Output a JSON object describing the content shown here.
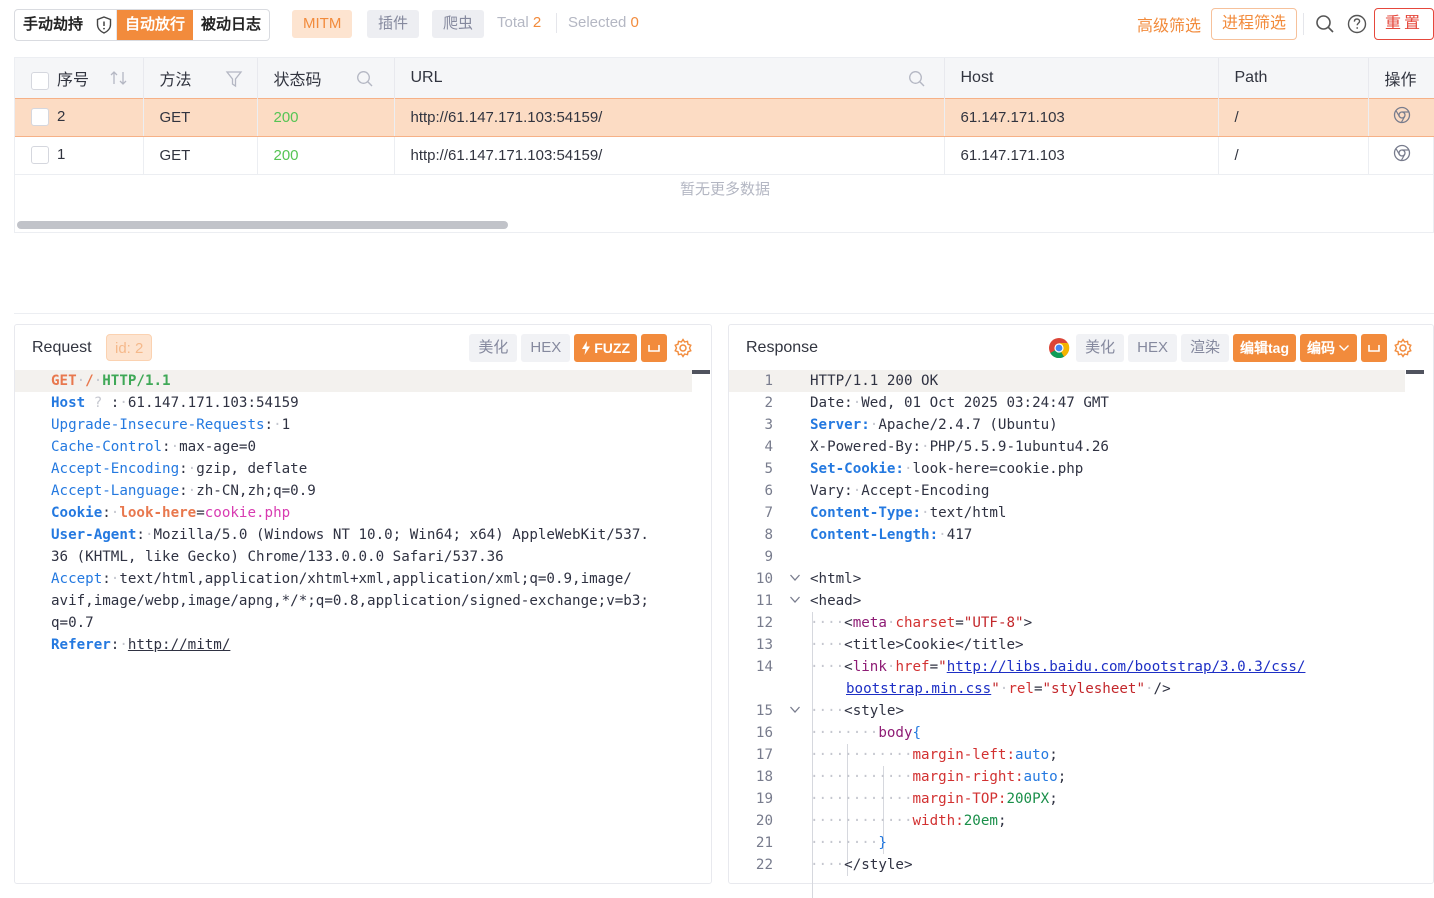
{
  "toolbar": {
    "seg_manual": "手动劫持",
    "seg_auto": "自动放行",
    "seg_passive": "被动日志",
    "tag_mitm": "MITM",
    "tag_plugin": "插件",
    "tag_crawler": "爬虫",
    "total_label": "Total",
    "total_value": "2",
    "selected_label": "Selected",
    "selected_value": "0",
    "advanced_filter": "高级筛选",
    "process_filter": "进程筛选",
    "reset": "重置"
  },
  "table": {
    "headers": {
      "seq": "序号",
      "method": "方法",
      "status": "状态码",
      "url": "URL",
      "host": "Host",
      "path": "Path",
      "ops": "操作"
    },
    "rows": [
      {
        "seq": "2",
        "method": "GET",
        "status": "200",
        "url": "http://61.147.171.103:54159/",
        "host": "61.147.171.103",
        "path": "/",
        "selected": true
      },
      {
        "seq": "1",
        "method": "GET",
        "status": "200",
        "url": "http://61.147.171.103:54159/",
        "host": "61.147.171.103",
        "path": "/",
        "selected": false
      }
    ],
    "no_more": "暂无更多数据"
  },
  "request": {
    "title": "Request",
    "id_tag": "id: 2",
    "btn_beautify": "美化",
    "btn_hex": "HEX",
    "btn_fuzz": "FUZZ",
    "lines": {
      "l1_method": "GET",
      "l1_path": "/",
      "l1_ver": "HTTP/1.1",
      "l2_key": "Host",
      "l2_val": "61.147.171.103:54159",
      "l3_key": "Upgrade-Insecure-Requests",
      "l3_val": "1",
      "l4_key": "Cache-Control",
      "l4_val": "max-age=0",
      "l5_key": "Accept-Encoding",
      "l5_val": "gzip, deflate",
      "l6_key": "Accept-Language",
      "l6_val": "zh-CN,zh;q=0.9",
      "l7_key": "Cookie",
      "l7_name": "look-here",
      "l7_val": "cookie.php",
      "l8_key": "User-Agent",
      "l8_val": "Mozilla/5.0 (Windows NT 10.0; Win64; x64) AppleWebKit/537.",
      "l9_val": "36 (KHTML, like Gecko) Chrome/133.0.0.0 Safari/537.36",
      "l10_key": "Accept",
      "l10_val": "text/html,application/xhtml+xml,application/xml;q=0.9,image/",
      "l11_val": "avif,image/webp,image/apng,*/*;q=0.8,application/signed-exchange;v=b3;",
      "l12_val": "q=0.7",
      "l13_key": "Referer",
      "l13_val": "http://mitm/"
    }
  },
  "response": {
    "title": "Response",
    "btn_beautify": "美化",
    "btn_hex": "HEX",
    "btn_render": "渲染",
    "btn_edit_tag": "编辑tag",
    "btn_encode": "编码",
    "line_numbers": [
      "1",
      "2",
      "3",
      "4",
      "5",
      "6",
      "7",
      "8",
      "9",
      "10",
      "11",
      "12",
      "13",
      "14",
      "15",
      "16",
      "17",
      "18",
      "19",
      "20",
      "21",
      "22"
    ],
    "l1": "HTTP/1.1 200 OK",
    "l2_key": "Date",
    "l2_val": "Wed, 01 Oct 2025 03:24:47 GMT",
    "l3_key": "Server",
    "l3_val": "Apache/2.4.7 (Ubuntu)",
    "l4_key": "X-Powered-By",
    "l4_val": "PHP/5.5.9-1ubuntu4.26",
    "l5_key": "Set-Cookie",
    "l5_val": "look-here=cookie.php",
    "l6_key": "Vary",
    "l6_val": "Accept-Encoding",
    "l7_key": "Content-Type",
    "l7_val": "text/html",
    "l8_key": "Content-Length",
    "l8_val": "417",
    "l10": "<html>",
    "l11": "<head>",
    "l12_tag": "meta",
    "l12_attr": "charset",
    "l12_val": "\"UTF-8\"",
    "l13_open": "title",
    "l13_text": "Cookie",
    "l14_tag": "link",
    "l14_attr": "href",
    "l14_url1": "http://libs.baidu.com/bootstrap/3.0.3/css/",
    "l14_url2": "bootstrap.min.css",
    "l14_attr2": "rel",
    "l14_val2": "\"stylesheet\"",
    "l15": "style",
    "l16": "body",
    "l17_prop": "margin-left",
    "l17_val": "auto",
    "l18_prop": "margin-right",
    "l18_val": "auto",
    "l19_prop": "margin-TOP",
    "l19_val": "200PX",
    "l20_prop": "width",
    "l20_val": "20em",
    "l22": "style"
  }
}
